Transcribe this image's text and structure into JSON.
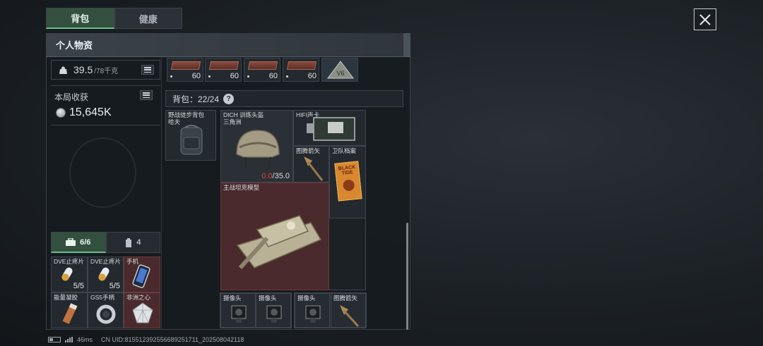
{
  "tabs": [
    {
      "label": "背包",
      "active": true
    },
    {
      "label": "健康",
      "active": false
    }
  ],
  "panel": {
    "title": "个人物资"
  },
  "weight": {
    "current": "39.5",
    "max": "/78千克"
  },
  "harvest": {
    "label": "本局收获",
    "value": "15,645K"
  },
  "pouch_tabs": [
    {
      "label": "6/6",
      "icon": "toolbox-icon",
      "active": true
    },
    {
      "label": "4",
      "icon": "canister-icon",
      "active": false
    }
  ],
  "pouch_items": [
    {
      "name": "DVE止疼片",
      "qty": "5/5",
      "icon": "pill-icon"
    },
    {
      "name": "DVE止疼片",
      "qty": "5/5",
      "icon": "pill-icon"
    },
    {
      "name": "手机",
      "qty": "",
      "icon": "phone-icon"
    },
    {
      "name": "能量凝胶",
      "qty": "",
      "icon": "gel-icon"
    },
    {
      "name": "GS5手柄",
      "qty": "",
      "icon": "controller-icon"
    },
    {
      "name": "非洲之心",
      "qty": "",
      "icon": "diamond-icon"
    }
  ],
  "top_items": [
    {
      "qty": "60"
    },
    {
      "qty": "60"
    },
    {
      "qty": "60"
    },
    {
      "qty": "60"
    }
  ],
  "top_badge": {
    "text": "V6"
  },
  "backpack": {
    "label": "背包：22/24",
    "help": "?"
  },
  "backpack_item": {
    "name": "野战徒步背包",
    "sub": "哈夫"
  },
  "grid_items": {
    "helmet": {
      "name": "DICH 训练头盔",
      "sub": "三角洲",
      "dur_current": "0.0",
      "dur_max": "/35.0"
    },
    "hifi": {
      "name": "HIFI声卡"
    },
    "arrow": {
      "name": "图腾箭矢"
    },
    "file": {
      "name": "卫队档案",
      "file_text": "BLACK TIDE"
    },
    "tank": {
      "name": "主战坦克模型"
    }
  },
  "bottom_items": [
    {
      "name": "摄像头"
    },
    {
      "name": "摄像头"
    },
    {
      "name": "摄像头"
    },
    {
      "name": "图腾箭矢"
    }
  ],
  "status": {
    "ping": "46ms",
    "uid": "CN UID:815512392556689251711_20250804211​8"
  },
  "colors": {
    "accent_green": "#6bbd8a",
    "tab_active": "#33503f",
    "slot_red": "#4a2a2c",
    "durability_red": "#e04a4a"
  }
}
